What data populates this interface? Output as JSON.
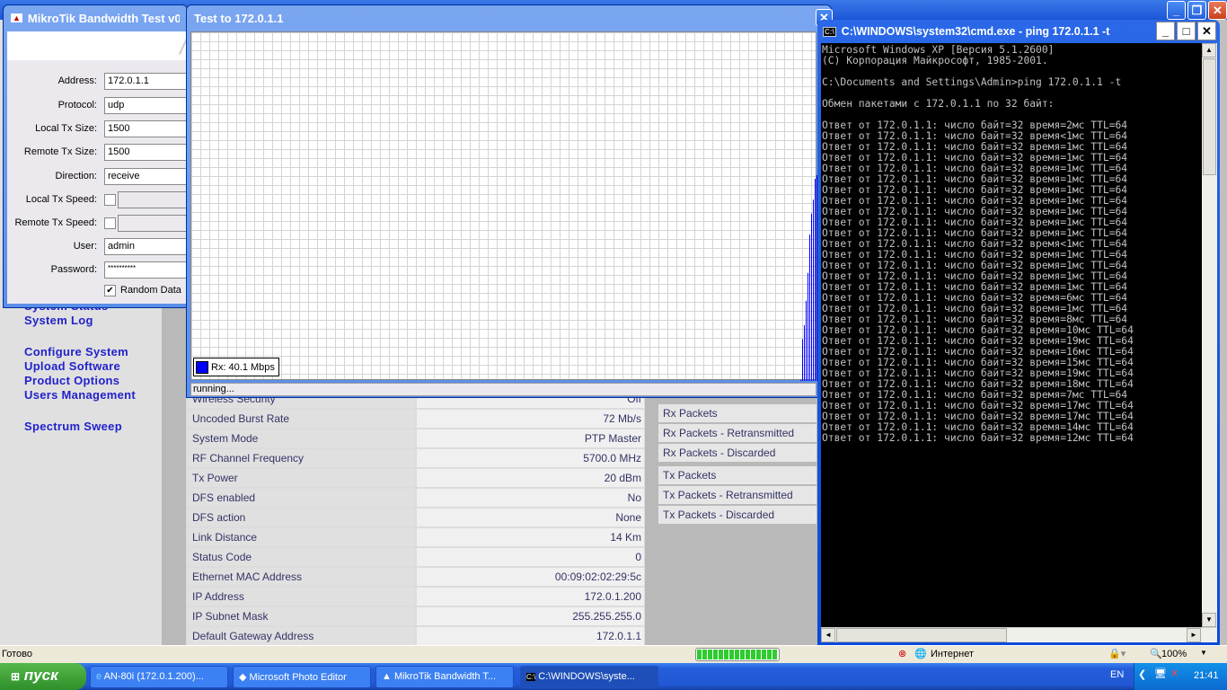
{
  "ie": {
    "status": "Готово",
    "zone": "Интернет",
    "zoom": "100%",
    "progress_percent": 100
  },
  "sidebar": {
    "links": [
      "System Status",
      "System Log",
      "Configure System",
      "Upload Software",
      "Product Options",
      "Users Management",
      "Spectrum Sweep"
    ]
  },
  "status_table": {
    "partial_row": {
      "label": "Wireless Security",
      "value": "Off"
    },
    "rows": [
      [
        "Uncoded Burst Rate",
        "72 Mb/s"
      ],
      [
        "System Mode",
        "PTP Master"
      ],
      [
        "RF Channel Frequency",
        "5700.0 MHz"
      ],
      [
        "Tx Power",
        "20 dBm"
      ],
      [
        "DFS enabled",
        "No"
      ],
      [
        "DFS action",
        "None"
      ],
      [
        "Link Distance",
        "14 Km"
      ],
      [
        "Status Code",
        "0"
      ],
      [
        "Ethernet MAC Address",
        "00:09:02:02:29:5c"
      ],
      [
        "IP Address",
        "172.0.1.200"
      ],
      [
        "IP Subnet Mask",
        "255.255.255.0"
      ],
      [
        "Default Gateway Address",
        "172.0.1.1"
      ]
    ]
  },
  "packets": [
    "Rx Packets",
    "Rx Packets - Retransmitted",
    "Rx Packets - Discarded",
    "Tx Packets",
    "Tx Packets - Retransmitted",
    "Tx Packets - Discarded"
  ],
  "bwtest": {
    "title": "MikroTik Bandwidth Test v0.",
    "fields": {
      "address_label": "Address:",
      "address": "172.0.1.1",
      "protocol_label": "Protocol:",
      "protocol": "udp",
      "local_tx_size_label": "Local Tx Size:",
      "local_tx_size": "1500",
      "remote_tx_size_label": "Remote Tx Size:",
      "remote_tx_size": "1500",
      "direction_label": "Direction:",
      "direction": "receive",
      "local_tx_speed_label": "Local Tx Speed:",
      "remote_tx_speed_label": "Remote Tx Speed:",
      "user_label": "User:",
      "user": "admin",
      "password_label": "Password:",
      "password": "**********",
      "random_data_label": "Random Data"
    },
    "random_data_checked": true
  },
  "testwin": {
    "title": "Test to 172.0.1.1",
    "legend": "Rx: 40.1 Mbps",
    "status": "running...",
    "color": "#0000ff"
  },
  "chart_data": {
    "type": "bar",
    "title": "Test to 172.0.1.1",
    "series": [
      {
        "name": "Rx",
        "values": [
          0.003,
          0.12,
          0.16,
          0.23,
          0.31,
          0.42,
          0.48,
          0.52,
          0.58,
          0.59
        ]
      }
    ],
    "ylim": [
      0,
      1
    ],
    "grid": true,
    "legend": "bottom-left"
  },
  "cmd": {
    "title": "C:\\WINDOWS\\system32\\cmd.exe - ping 172.0.1.1 -t",
    "header": [
      "Microsoft Windows XP [Версия 5.1.2600]",
      "(C) Корпорация Майкрософт, 1985-2001.",
      "",
      "C:\\Documents and Settings\\Admin>ping 172.0.1.1 -t",
      "",
      "Обмен пакетами с 172.0.1.1 по 32 байт:",
      ""
    ],
    "reply_prefix": "Ответ от 172.0.1.1: число байт=32 время",
    "times": [
      "=2мс",
      "<1мс",
      "=1мс",
      "=1мс",
      "=1мс",
      "=1мс",
      "=1мс",
      "=1мс",
      "=1мс",
      "=1мс",
      "=1мс",
      "<1мс",
      "=1мс",
      "=1мс",
      "=1мс",
      "=1мс",
      "=6мс",
      "=1мс",
      "=8мс",
      "=10мс",
      "=19мс",
      "=16мс",
      "=15мс",
      "=19мс",
      "=18мс",
      "=7мс",
      "=17мс",
      "=17мс",
      "=14мс",
      "=12мс"
    ],
    "ttl": "TTL=64"
  },
  "taskbar": {
    "start": "пуск",
    "tasks": [
      "AN-80i (172.0.1.200)...",
      "Microsoft Photo Editor",
      "MikroTik Bandwidth T...",
      "C:\\WINDOWS\\syste..."
    ],
    "lang": "EN",
    "clock": "21:41"
  }
}
